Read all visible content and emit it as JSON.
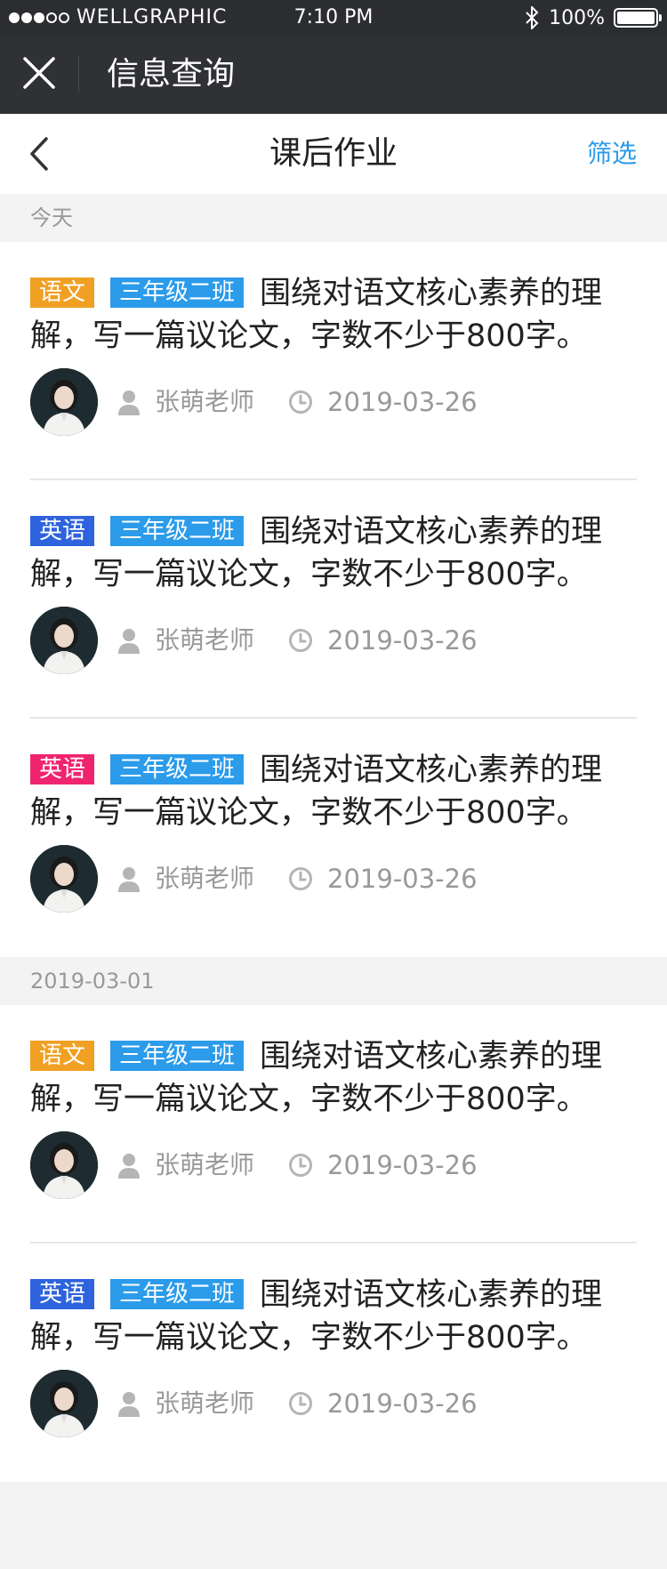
{
  "status_bar": {
    "carrier": "WELLGRAPHIC",
    "time": "7:10 PM",
    "battery": "100%"
  },
  "app_bar": {
    "title": "信息查询"
  },
  "nav_bar": {
    "title": "课后作业",
    "filter": "筛选"
  },
  "colors": {
    "tag_chinese": "#f0a023",
    "tag_english_blue": "#2e63dd",
    "tag_english_pink": "#f0246e",
    "tag_class": "#2b9bea",
    "accent": "#2b9bea"
  },
  "sections": [
    {
      "header": "今天",
      "items": [
        {
          "subject": "语文",
          "subject_color": "#f0a023",
          "class": "三年级二班",
          "text": "围绕对语文核心素养的理解，写一篇议论文，字数不少于800字。",
          "teacher": "张萌老师",
          "date": "2019-03-26"
        },
        {
          "subject": "英语",
          "subject_color": "#2e63dd",
          "class": "三年级二班",
          "text": "围绕对语文核心素养的理解，写一篇议论文，字数不少于800字。",
          "teacher": "张萌老师",
          "date": "2019-03-26"
        },
        {
          "subject": "英语",
          "subject_color": "#f0246e",
          "class": "三年级二班",
          "text": "围绕对语文核心素养的理解，写一篇议论文，字数不少于800字。",
          "teacher": "张萌老师",
          "date": "2019-03-26"
        }
      ]
    },
    {
      "header": "2019-03-01",
      "items": [
        {
          "subject": "语文",
          "subject_color": "#f0a023",
          "class": "三年级二班",
          "text": "围绕对语文核心素养的理解，写一篇议论文，字数不少于800字。",
          "teacher": "张萌老师",
          "date": "2019-03-26"
        },
        {
          "subject": "英语",
          "subject_color": "#2e63dd",
          "class": "三年级二班",
          "text": "围绕对语文核心素养的理解，写一篇议论文，字数不少于800字。",
          "teacher": "张萌老师",
          "date": "2019-03-26"
        }
      ]
    }
  ]
}
